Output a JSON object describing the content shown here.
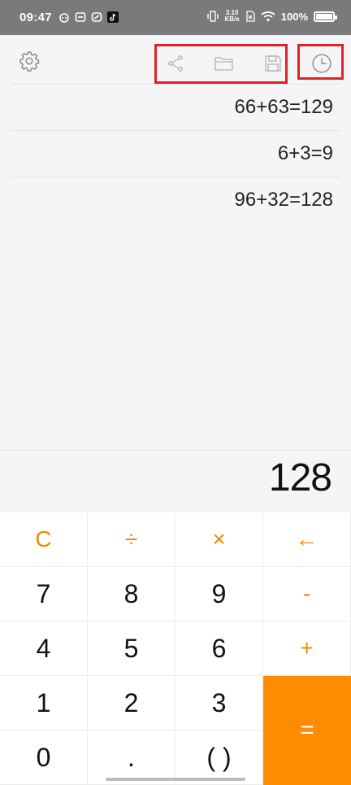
{
  "status_bar": {
    "time": "09:47",
    "net_speed_value": "3.10",
    "net_speed_unit": "KB/s",
    "battery": "100%"
  },
  "toolbar": {
    "settings_icon": "gear-icon",
    "share_icon": "share-icon",
    "folder_icon": "folder-icon",
    "save_icon": "floppy-icon",
    "history_icon": "clock-icon",
    "icon_color": "#b0b0b0",
    "annotation_color": "#e0202a"
  },
  "history": [
    {
      "expression": "66+63=129"
    },
    {
      "expression": "6+3=9"
    },
    {
      "expression": "96+32=128"
    }
  ],
  "display": {
    "value": "128"
  },
  "keypad": {
    "accent_color": "#ff8c00",
    "rows": [
      [
        "C",
        "÷",
        "×",
        "←"
      ],
      [
        "7",
        "8",
        "9",
        "-"
      ],
      [
        "4",
        "5",
        "6",
        "+"
      ],
      [
        "1",
        "2",
        "3",
        "="
      ],
      [
        "0",
        ".",
        "( )"
      ]
    ]
  }
}
